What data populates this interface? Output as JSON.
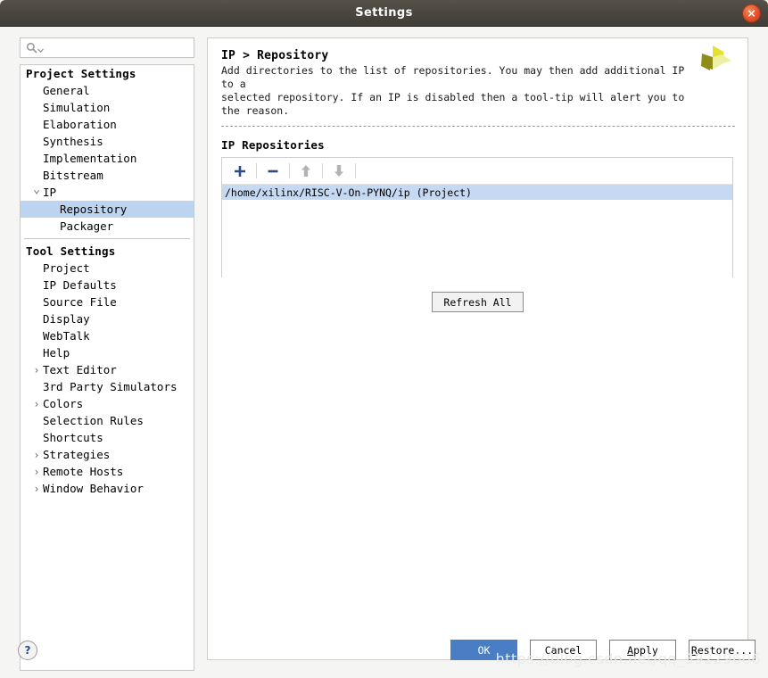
{
  "window": {
    "title": "Settings",
    "close_icon": "close-icon",
    "accent_blue": "#4a7ec4",
    "selection_blue": "#bcd4f0",
    "titlebar_color": "#4b4740",
    "close_button_color": "#e2502b"
  },
  "search": {
    "value": "",
    "placeholder": "",
    "icon": "search-icon",
    "dropdown_icon": "chevron-down-icon"
  },
  "sidebar": {
    "groups": [
      {
        "label": "Project Settings",
        "items": [
          {
            "label": "General",
            "indent": 1,
            "arrow": "",
            "selected": false
          },
          {
            "label": "Simulation",
            "indent": 1,
            "arrow": "",
            "selected": false
          },
          {
            "label": "Elaboration",
            "indent": 1,
            "arrow": "",
            "selected": false
          },
          {
            "label": "Synthesis",
            "indent": 1,
            "arrow": "",
            "selected": false
          },
          {
            "label": "Implementation",
            "indent": 1,
            "arrow": "",
            "selected": false
          },
          {
            "label": "Bitstream",
            "indent": 1,
            "arrow": "",
            "selected": false
          },
          {
            "label": "IP",
            "indent": 1,
            "arrow": "down",
            "selected": false
          },
          {
            "label": "Repository",
            "indent": 2,
            "arrow": "",
            "selected": true
          },
          {
            "label": "Packager",
            "indent": 2,
            "arrow": "",
            "selected": false
          }
        ]
      },
      {
        "label": "Tool Settings",
        "items": [
          {
            "label": "Project",
            "indent": 1,
            "arrow": "",
            "selected": false
          },
          {
            "label": "IP Defaults",
            "indent": 1,
            "arrow": "",
            "selected": false
          },
          {
            "label": "Source File",
            "indent": 1,
            "arrow": "",
            "selected": false
          },
          {
            "label": "Display",
            "indent": 1,
            "arrow": "",
            "selected": false
          },
          {
            "label": "WebTalk",
            "indent": 1,
            "arrow": "",
            "selected": false
          },
          {
            "label": "Help",
            "indent": 1,
            "arrow": "",
            "selected": false
          },
          {
            "label": "Text Editor",
            "indent": 1,
            "arrow": "right",
            "selected": false
          },
          {
            "label": "3rd Party Simulators",
            "indent": 1,
            "arrow": "",
            "selected": false
          },
          {
            "label": "Colors",
            "indent": 1,
            "arrow": "right",
            "selected": false
          },
          {
            "label": "Selection Rules",
            "indent": 1,
            "arrow": "",
            "selected": false
          },
          {
            "label": "Shortcuts",
            "indent": 1,
            "arrow": "",
            "selected": false
          },
          {
            "label": "Strategies",
            "indent": 1,
            "arrow": "right",
            "selected": false
          },
          {
            "label": "Remote Hosts",
            "indent": 1,
            "arrow": "right",
            "selected": false
          },
          {
            "label": "Window Behavior",
            "indent": 1,
            "arrow": "right",
            "selected": false
          }
        ]
      }
    ]
  },
  "main": {
    "breadcrumb": "IP > Repository",
    "description": "Add directories to the list of repositories. You may then add additional IP to a\nselected repository. If an IP is disabled then a tool-tip will alert you to the reason.",
    "logo": "xilinx-logo",
    "section_title": "IP Repositories",
    "toolbar": [
      {
        "name": "add-repository-button",
        "icon": "plus-icon",
        "enabled": true
      },
      {
        "name": "remove-repository-button",
        "icon": "minus-icon",
        "enabled": true
      },
      {
        "name": "move-up-button",
        "icon": "arrow-up-icon",
        "enabled": false
      },
      {
        "name": "move-down-button",
        "icon": "arrow-down-icon",
        "enabled": false
      }
    ],
    "repositories": [
      {
        "path": "/home/xilinx/RISC-V-On-PYNQ/ip (Project)",
        "selected": true
      }
    ],
    "refresh_label": "Refresh All"
  },
  "footer": {
    "help_icon": "question-mark-icon",
    "buttons": [
      {
        "label": "OK",
        "primary": true,
        "underline_index": -1
      },
      {
        "label": "Cancel",
        "primary": false,
        "underline_index": -1
      },
      {
        "label": "Apply",
        "primary": false,
        "underline_index": 0
      },
      {
        "label": "Restore...",
        "primary": false,
        "underline_index": 0
      }
    ]
  },
  "watermark": "https://blog.csdn.net/qq_39229606"
}
